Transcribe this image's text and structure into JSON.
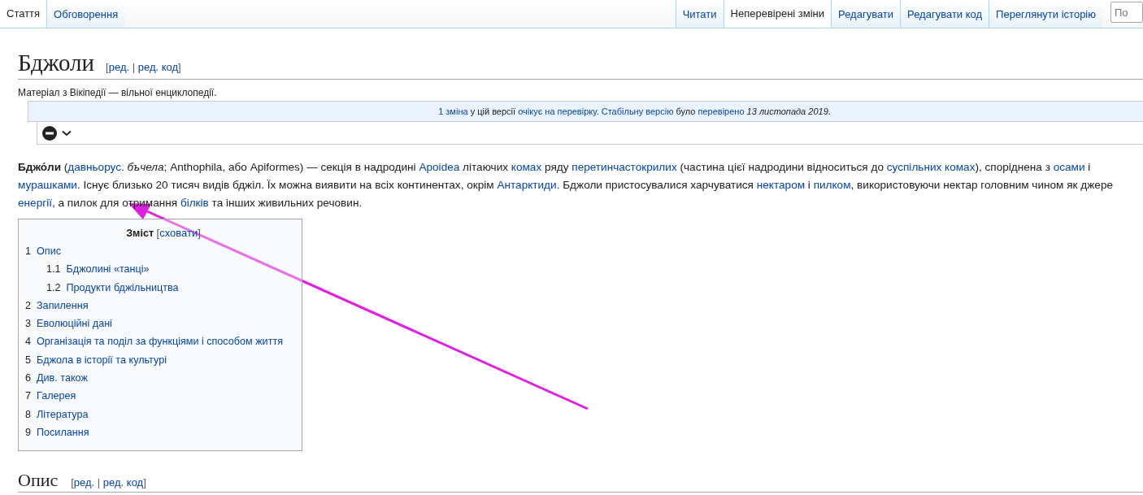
{
  "tabs_left": [
    {
      "label": "Стаття",
      "selected": true
    },
    {
      "label": "Обговорення",
      "selected": false
    }
  ],
  "tabs_right": [
    {
      "label": "Читати",
      "selected": false
    },
    {
      "label": "Неперевірені зміни",
      "selected": true
    },
    {
      "label": "Редагувати",
      "selected": false
    },
    {
      "label": "Редагувати код",
      "selected": false
    },
    {
      "label": "Переглянути історію",
      "selected": false
    }
  ],
  "search": {
    "placeholder": "По"
  },
  "title": "Бджоли",
  "title_edit": {
    "open": "[",
    "links": [
      "ред.",
      "ред. код"
    ],
    "separator": "|",
    "close": "]"
  },
  "tagline": "Матеріал з Вікіпедії — вільної енциклопедії.",
  "review_notice": [
    {
      "kind": "link",
      "text": "1 зміна"
    },
    {
      "kind": "plain",
      "text": " у цій версії "
    },
    {
      "kind": "link",
      "text": "очікує на перевірку"
    },
    {
      "kind": "plain",
      "text": ". "
    },
    {
      "kind": "link",
      "text": "Стабільну версію"
    },
    {
      "kind": "plain",
      "text": " було "
    },
    {
      "kind": "link",
      "text": "перевірено"
    },
    {
      "kind": "italic",
      "text": " 13 листопада 2019"
    },
    {
      "kind": "plain",
      "text": "."
    }
  ],
  "intro_lines": [
    [
      {
        "kind": "bold",
        "text": "Бджо́ли"
      },
      {
        "kind": "plain",
        "text": " ("
      },
      {
        "kind": "link",
        "text": "давньорус."
      },
      {
        "kind": "italic",
        "text": " бъчела"
      },
      {
        "kind": "plain",
        "text": "; Anthophila, або Apiformes) — секція в надродині "
      },
      {
        "kind": "link",
        "text": "Apoidea"
      },
      {
        "kind": "plain",
        "text": " літаючих "
      },
      {
        "kind": "link",
        "text": "комах"
      },
      {
        "kind": "plain",
        "text": " ряду "
      },
      {
        "kind": "link",
        "text": "перетинчастокрилих"
      },
      {
        "kind": "plain",
        "text": " (частина цієї надродини відноситься до "
      },
      {
        "kind": "link",
        "text": "суспільних комах"
      },
      {
        "kind": "plain",
        "text": "), споріднена з "
      },
      {
        "kind": "link",
        "text": "осами"
      },
      {
        "kind": "plain",
        "text": " і"
      }
    ],
    [
      {
        "kind": "link",
        "text": "мурашками"
      },
      {
        "kind": "plain",
        "text": ". Існує близько 20 тисяч видів бджіл. Їх можна виявити на всіх континентах, окрім "
      },
      {
        "kind": "link",
        "text": "Антарктиди"
      },
      {
        "kind": "plain",
        "text": ". Бджоли пристосувалися харчуватися "
      },
      {
        "kind": "link",
        "text": "нектаром"
      },
      {
        "kind": "plain",
        "text": " і "
      },
      {
        "kind": "link",
        "text": "пилком"
      },
      {
        "kind": "plain",
        "text": ", використовуючи нектар головним чином як джере"
      }
    ],
    [
      {
        "kind": "link",
        "text": "енергії"
      },
      {
        "kind": "plain",
        "text": ", а пилок для отримання "
      },
      {
        "kind": "link",
        "text": "білків"
      },
      {
        "kind": "plain",
        "text": " та інших живильних речовин."
      }
    ]
  ],
  "toc": {
    "title": "Зміст",
    "toggle_open": "[",
    "toggle": "сховати",
    "toggle_close": "]",
    "items": [
      {
        "number": "1",
        "label": "Опис",
        "children": [
          {
            "number": "1.1",
            "label": "Бджолині «танці»"
          },
          {
            "number": "1.2",
            "label": "Продукти бджільництва"
          }
        ]
      },
      {
        "number": "2",
        "label": "Запилення"
      },
      {
        "number": "3",
        "label": "Еволюційні дані"
      },
      {
        "number": "4",
        "label": "Організація та поділ за функціями і способом життя"
      },
      {
        "number": "5",
        "label": "Бджола в історії та культурі"
      },
      {
        "number": "6",
        "label": "Див. також"
      },
      {
        "number": "7",
        "label": "Галерея"
      },
      {
        "number": "8",
        "label": "Література"
      },
      {
        "number": "9",
        "label": "Посилання"
      }
    ]
  },
  "section": {
    "heading": "Опис",
    "edit": {
      "open": "[",
      "links": [
        "ред.",
        "ред. код"
      ],
      "separator": "|",
      "close": "]"
    }
  }
}
